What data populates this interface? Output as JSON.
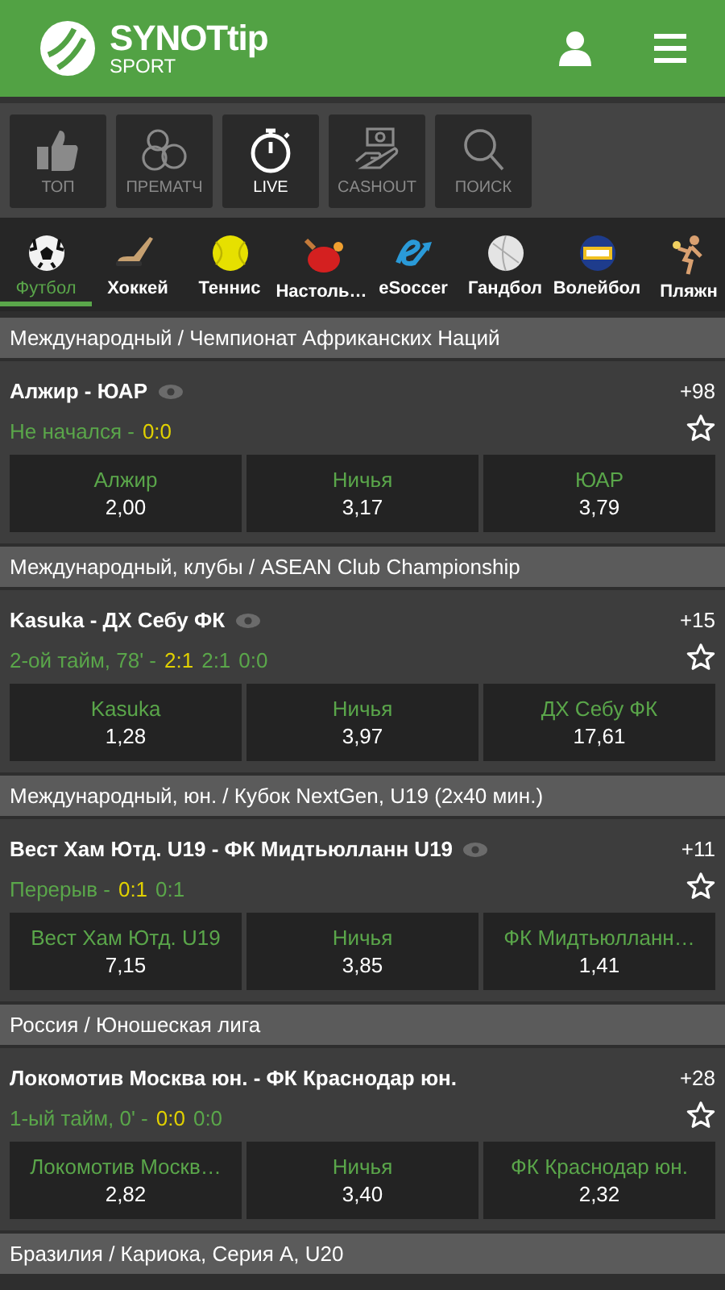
{
  "header": {
    "logo_text": "SYNOTtip",
    "logo_subtext": "SPORT"
  },
  "nav_tabs": [
    {
      "kind": "top",
      "label": "ТОП",
      "selected": false
    },
    {
      "kind": "prematch",
      "label": "ПРЕМАТЧ",
      "selected": false
    },
    {
      "kind": "live",
      "label": "LIVE",
      "selected": true
    },
    {
      "kind": "cashout",
      "label": "CASHOUT",
      "selected": false
    },
    {
      "kind": "search",
      "label": "ПОИСК",
      "selected": false
    }
  ],
  "sports": [
    {
      "kind": "football",
      "label": "Футбол",
      "selected": true
    },
    {
      "kind": "hockey",
      "label": "Хоккей",
      "selected": false
    },
    {
      "kind": "tennis",
      "label": "Теннис",
      "selected": false
    },
    {
      "kind": "tabletennis",
      "label": "Настоль…",
      "selected": false
    },
    {
      "kind": "esoccer",
      "label": "eSoccer",
      "selected": false
    },
    {
      "kind": "handball",
      "label": "Гандбол",
      "selected": false
    },
    {
      "kind": "volleyball",
      "label": "Волейбол",
      "selected": false
    },
    {
      "kind": "beach",
      "label": "Пляжн",
      "selected": false
    }
  ],
  "events": [
    {
      "league": "Международный / Чемпионат Африканских Наций",
      "match": "Алжир - ЮАР",
      "stream": true,
      "status": "Не начался -",
      "score": "0:0",
      "more": "+98",
      "odds": [
        {
          "label": "Алжир",
          "value": "2,00"
        },
        {
          "label": "Ничья",
          "value": "3,17"
        },
        {
          "label": "ЮАР",
          "value": "3,79"
        }
      ]
    },
    {
      "league": "Международный, клубы / ASEAN Club Championship",
      "match": "Kasuka - ДХ Себу ФК",
      "stream": true,
      "status": "2-ой тайм, 78' -",
      "score": "2:1",
      "extra_scores": [
        "2:1",
        "0:0"
      ],
      "more": "+15",
      "odds": [
        {
          "label": "Kasuka",
          "value": "1,28"
        },
        {
          "label": "Ничья",
          "value": "3,97"
        },
        {
          "label": "ДХ Себу ФК",
          "value": "17,61"
        }
      ]
    },
    {
      "league": "Международный, юн. / Кубок NextGen, U19 (2x40 мин.)",
      "match": "Вест Хам Ютд. U19 - ФК Мидтьюлланн U19",
      "stream": true,
      "status": "Перерыв -",
      "score": "0:1",
      "extra_scores": [
        "0:1"
      ],
      "more": "+11",
      "odds": [
        {
          "label": "Вест Хам Ютд. U19",
          "value": "7,15"
        },
        {
          "label": "Ничья",
          "value": "3,85"
        },
        {
          "label": "ФК Мидтьюлланн…",
          "value": "1,41"
        }
      ]
    },
    {
      "league": "Россия / Юношеская лига",
      "match": "Локомотив Москва юн. - ФК Краснодар юн.",
      "stream": false,
      "status": "1-ый тайм, 0' -",
      "score": "0:0",
      "extra_scores": [
        "0:0"
      ],
      "more": "+28",
      "odds": [
        {
          "label": "Локомотив Москв…",
          "value": "2,82"
        },
        {
          "label": "Ничья",
          "value": "3,40"
        },
        {
          "label": "ФК Краснодар юн.",
          "value": "2,32"
        }
      ]
    }
  ],
  "next_league": "Бразилия / Кариока, Серия А, U20"
}
